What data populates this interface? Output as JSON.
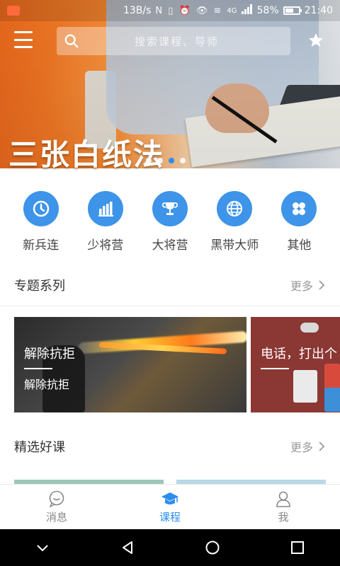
{
  "status_bar": {
    "speed": "13B/s",
    "icons": "N ▯ ⏰ 👁 ≋",
    "network": "4G",
    "battery": "58%",
    "time": "21:40"
  },
  "top_bar": {
    "search_placeholder": "搜索课程、导师"
  },
  "banner": {
    "title": "三张白纸法",
    "dots": 4,
    "active_dot": 2
  },
  "categories": [
    {
      "label": "新兵连",
      "icon": "clock-icon"
    },
    {
      "label": "少将营",
      "icon": "bar-chart-icon"
    },
    {
      "label": "大将营",
      "icon": "trophy-icon"
    },
    {
      "label": "黑带大师",
      "icon": "globe-icon"
    },
    {
      "label": "其他",
      "icon": "grid-icon"
    }
  ],
  "topic_series": {
    "title": "专题系列",
    "more": "更多",
    "cards": [
      {
        "title": "解除抗拒",
        "subtitle": "解除抗拒"
      },
      {
        "title": "电话，打出个"
      }
    ]
  },
  "featured": {
    "title": "精选好课",
    "more": "更多"
  },
  "tabs": [
    {
      "label": "消息",
      "icon": "chat-icon",
      "active": false
    },
    {
      "label": "课程",
      "icon": "graduation-cap-icon",
      "active": true
    },
    {
      "label": "我",
      "icon": "user-icon",
      "active": false
    }
  ],
  "colors": {
    "accent": "#2d8cf0",
    "category_circle": "#3d94e9"
  }
}
